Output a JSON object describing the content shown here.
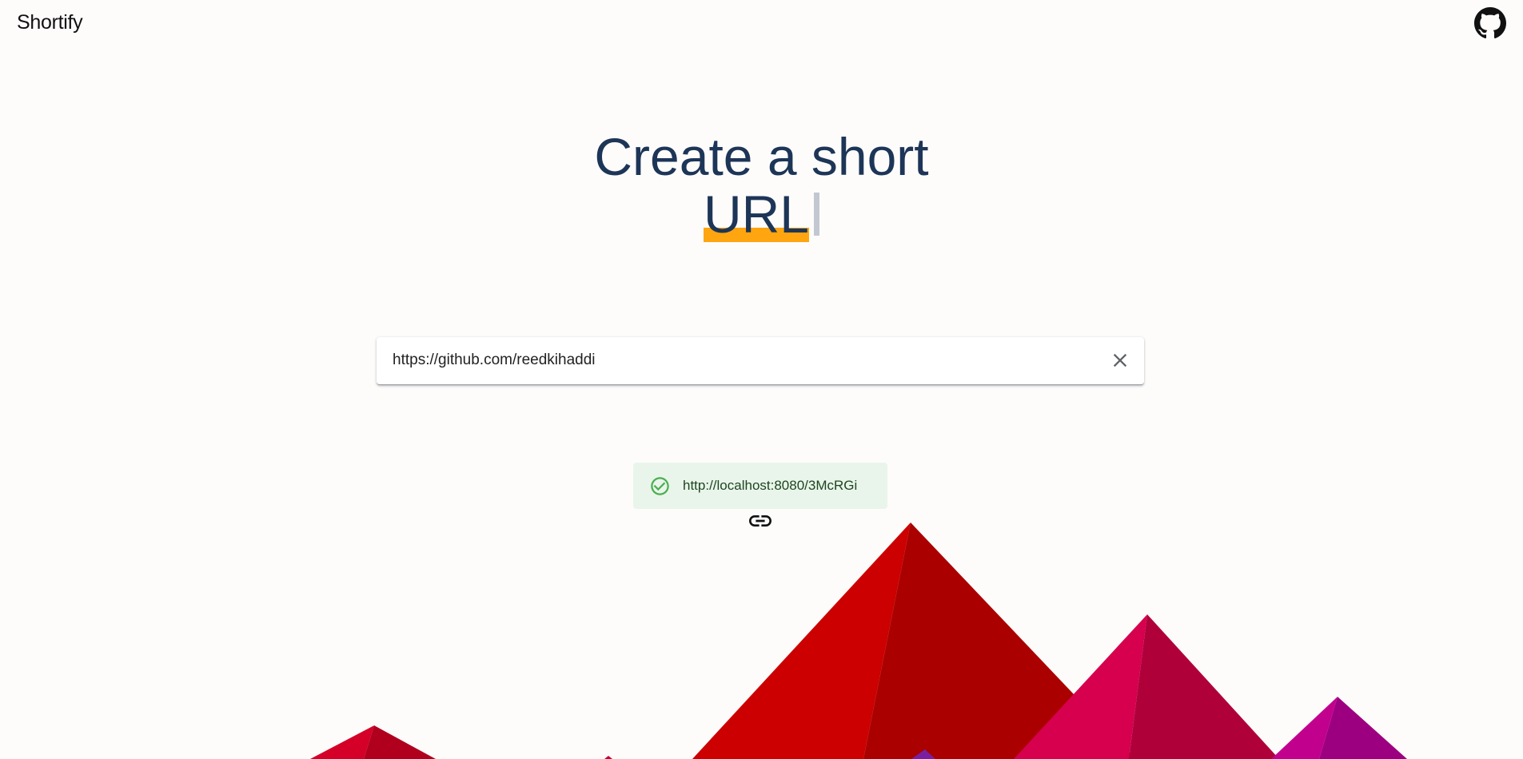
{
  "header": {
    "brand": "Shortify",
    "github_icon": "github-icon"
  },
  "hero": {
    "line1": "Create a short",
    "highlight_word": "URL"
  },
  "url_input": {
    "value": "https://github.com/reedkihaddi",
    "placeholder": "",
    "clear_icon": "close-icon"
  },
  "result": {
    "status_icon": "check-circle-icon",
    "short_url": "http://localhost:8080/3McRGi",
    "copy_icon": "link-icon"
  },
  "colors": {
    "title": "#1d3557",
    "highlight": "#ffa510",
    "success_bg": "#e9f5ea",
    "success_text": "#1e4620",
    "success_icon": "#4caf50",
    "background": "#fdfcfb"
  }
}
